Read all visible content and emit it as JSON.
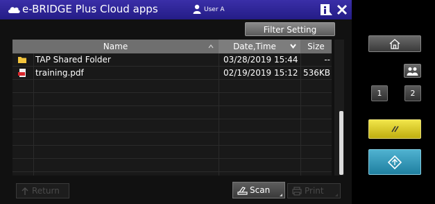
{
  "window": {
    "title": "e-BRIDGE Plus Cloud apps",
    "user": "User A"
  },
  "toolbar": {
    "filter_label": "Filter Setting"
  },
  "table": {
    "columns": {
      "name": "Name",
      "date": "Date,Time",
      "size": "Size"
    },
    "rows": [
      {
        "icon": "folder-icon",
        "name": "TAP Shared Folder",
        "date": "03/28/2019 15:44",
        "size": "--"
      },
      {
        "icon": "pdf-file-icon",
        "name": "training.pdf",
        "date": "02/19/2019 15:12",
        "size": "536KB"
      }
    ]
  },
  "bottom": {
    "return_label": "Return",
    "scan_label": "Scan",
    "print_label": "Print"
  },
  "panel": {
    "num1": "1",
    "num2": "2"
  },
  "colors": {
    "titlebar": "#2e2498",
    "clear_button": "#e3d62c",
    "start_button": "#3a9bbd",
    "header": "#6f6f6f"
  }
}
